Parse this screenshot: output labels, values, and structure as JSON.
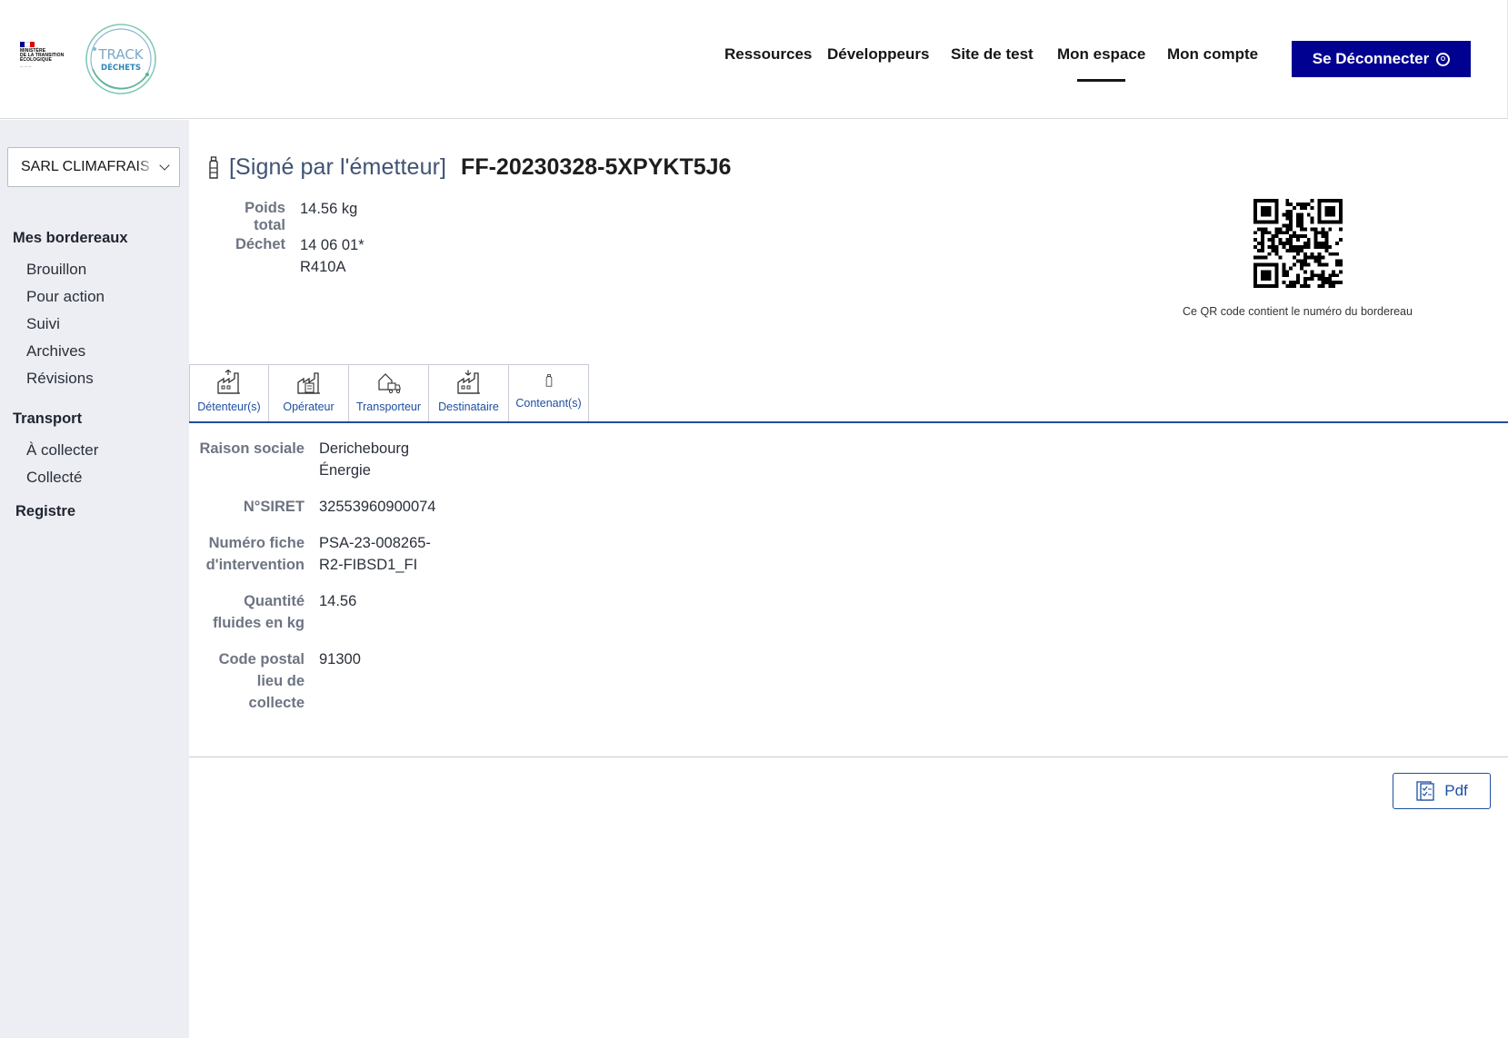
{
  "header": {
    "ministry_lines": [
      "MINISTÈRE",
      "DE LA TRANSITION",
      "ÉCOLOGIQUE"
    ],
    "logo_name": "Trackdéchets",
    "logo_lines": [
      "TRACK",
      "DÉCHETS"
    ],
    "nav": [
      {
        "label": "Ressources",
        "active": false
      },
      {
        "label": "Développeurs",
        "active": false
      },
      {
        "label": "Site de test",
        "active": false
      },
      {
        "label": "Mon espace",
        "active": true
      },
      {
        "label": "Mon compte",
        "active": false
      }
    ],
    "logout_label": "Se Déconnecter",
    "logout_icon": "user-circle-icon",
    "colors": {
      "primary": "#000091",
      "link": "#1d4fa1"
    }
  },
  "sidebar": {
    "company_select": "SARL CLIMAFRAIS",
    "sections": [
      {
        "title": "Mes bordereaux",
        "items": [
          "Brouillon",
          "Pour action",
          "Suivi",
          "Archives",
          "Révisions"
        ]
      },
      {
        "title": "Transport",
        "items": [
          "À collecter",
          "Collecté"
        ]
      },
      {
        "title": "Registre",
        "items": []
      }
    ]
  },
  "bsd": {
    "status": "[Signé par l'émetteur]",
    "readable_id": "FF-20230328-5XPYKT5J6",
    "summary": [
      {
        "label": "Poids total",
        "value": "14.56 kg"
      },
      {
        "label": "Déchet",
        "value_lines": [
          "14 06 01*",
          "R410A"
        ]
      }
    ],
    "qr_caption": "Ce QR code contient le numéro du bordereau"
  },
  "tabs": [
    {
      "label": "Détenteur(s)",
      "icon": "factory-upload-icon",
      "active": true
    },
    {
      "label": "Opérateur",
      "icon": "factory-document-icon",
      "active": false
    },
    {
      "label": "Transporteur",
      "icon": "truck-house-icon",
      "active": false
    },
    {
      "label": "Destinataire",
      "icon": "factory-download-icon",
      "active": false
    },
    {
      "label": "Contenant(s)",
      "icon": "bottle-icon",
      "active": false
    }
  ],
  "details": [
    {
      "label_lines": [
        "Raison sociale"
      ],
      "value_lines": [
        "Derichebourg",
        "Énergie"
      ]
    },
    {
      "label_lines": [
        "N°SIRET"
      ],
      "value_lines": [
        "32553960900074"
      ]
    },
    {
      "label_lines": [
        "Numéro fiche",
        "d'intervention"
      ],
      "value_lines": [
        "PSA-23-008265-",
        "R2-FIBSD1_FI"
      ]
    },
    {
      "label_lines": [
        "Quantité",
        "fluides en kg"
      ],
      "value_lines": [
        "14.56"
      ]
    },
    {
      "label_lines": [
        "Code postal",
        "lieu de",
        "collecte"
      ],
      "value_lines": [
        "91300"
      ]
    }
  ],
  "actions": {
    "pdf_label": "Pdf",
    "pdf_icon": "document-check-icon"
  }
}
